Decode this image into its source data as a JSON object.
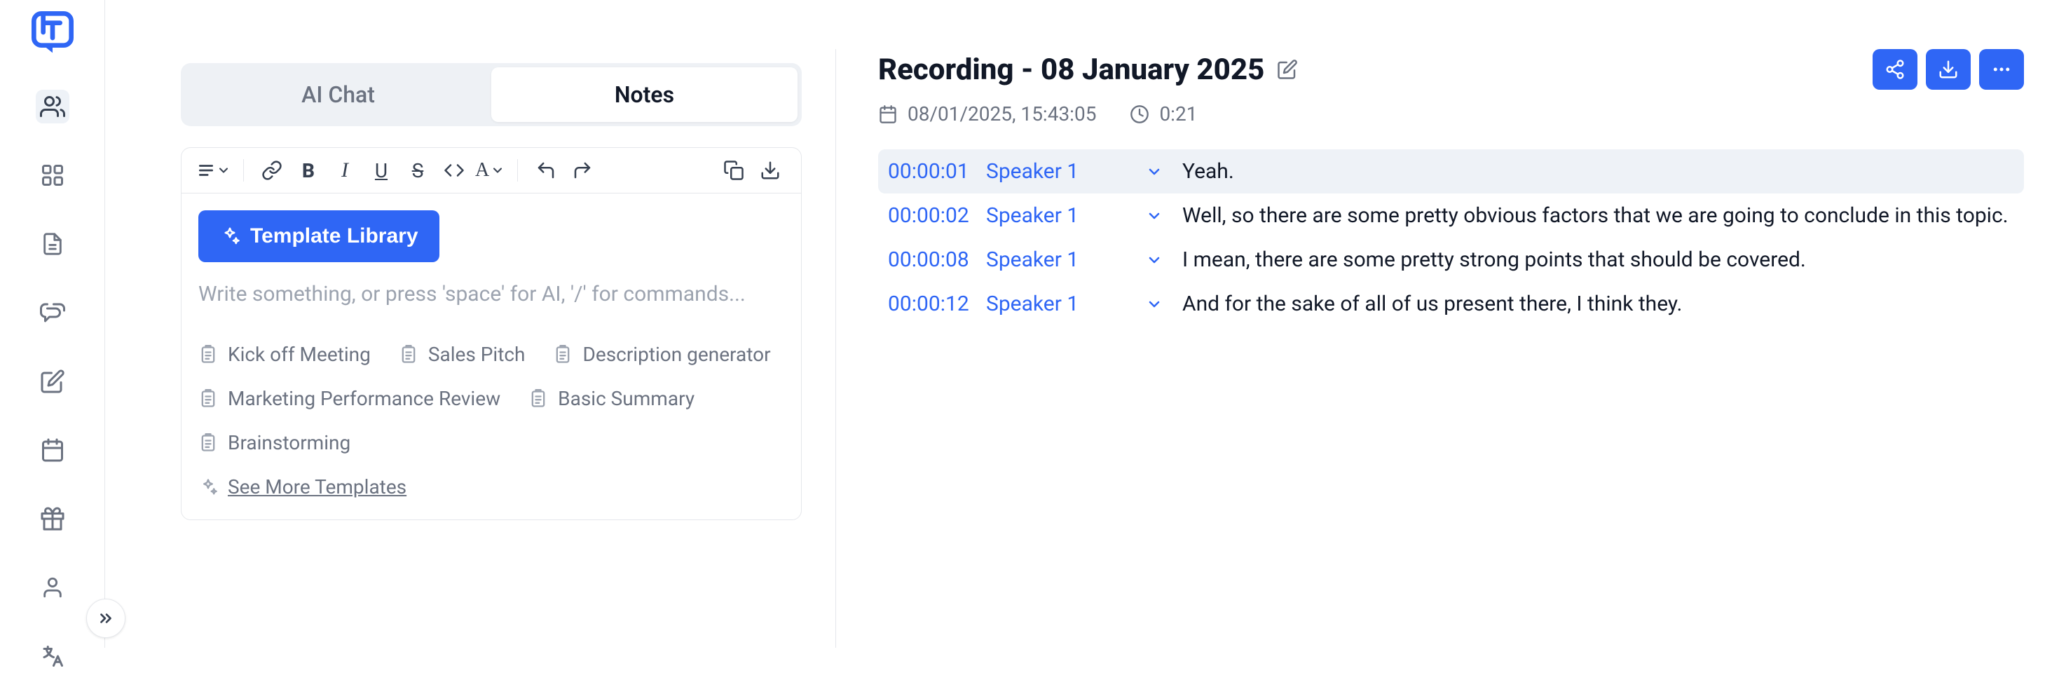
{
  "tabs": {
    "ai_chat": "AI Chat",
    "notes": "Notes"
  },
  "editor": {
    "template_library_btn": "Template Library",
    "placeholder": "Write something, or press 'space' for AI, '/' for commands...",
    "templates": [
      "Kick off Meeting",
      "Sales Pitch",
      "Description generator",
      "Marketing Performance Review",
      "Basic Summary",
      "Brainstorming"
    ],
    "see_more_label": "See More Templates"
  },
  "recording": {
    "title": "Recording - 08 January 2025",
    "date": "08/01/2025, 15:43:05",
    "duration": "0:21"
  },
  "transcript": [
    {
      "time": "00:00:01",
      "speaker": "Speaker 1",
      "text": "Yeah.",
      "active": true
    },
    {
      "time": "00:00:02",
      "speaker": "Speaker 1",
      "text": "Well, so there are some pretty obvious factors that we are going to conclude in this topic.",
      "active": false
    },
    {
      "time": "00:00:08",
      "speaker": "Speaker 1",
      "text": "I mean, there are some pretty strong points that should be covered.",
      "active": false
    },
    {
      "time": "00:00:12",
      "speaker": "Speaker 1",
      "text": "And for the sake of all of us present there, I think they.",
      "active": false
    }
  ]
}
